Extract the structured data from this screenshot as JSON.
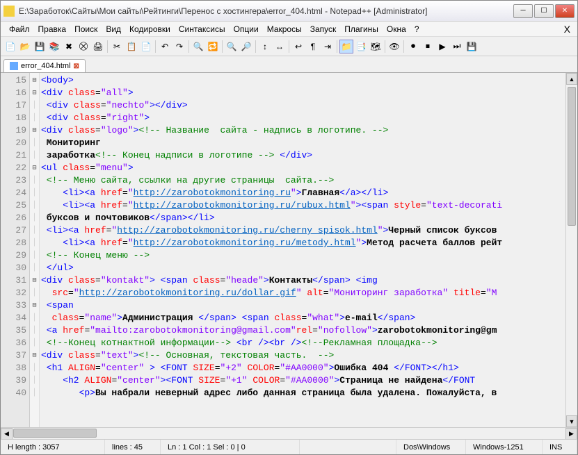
{
  "title": "E:\\Заработок\\Сайты\\Мои сайты\\Рейтинги\\Перенос с хостингера\\error_404.html - Notepad++ [Administrator]",
  "menu": [
    "Файл",
    "Правка",
    "Поиск",
    "Вид",
    "Кодировки",
    "Синтаксисы",
    "Опции",
    "Макросы",
    "Запуск",
    "Плагины",
    "Окна",
    "?"
  ],
  "tab": {
    "name": "error_404.html"
  },
  "status": {
    "length": "H length : 3057",
    "lines": "lines : 45",
    "pos": "Ln : 1   Col : 1   Sel : 0 | 0",
    "eol": "Dos\\Windows",
    "enc": "Windows-1251",
    "mode": "INS"
  },
  "lines": [
    15,
    16,
    17,
    18,
    19,
    20,
    21,
    22,
    23,
    24,
    25,
    26,
    27,
    28,
    29,
    30,
    31,
    32,
    33,
    34,
    35,
    36,
    37,
    38,
    39,
    40
  ],
  "fold": [
    "⊟",
    "⊟",
    "",
    "",
    "⊟",
    "",
    "",
    "⊟",
    "",
    "",
    "",
    "",
    "",
    "",
    "",
    "",
    "⊟",
    "",
    "⊟",
    "",
    "",
    "",
    "⊟",
    "",
    "",
    ""
  ],
  "c15": {
    "tag1": "<body>"
  },
  "c16": {
    "t1": "<div ",
    "a": "class",
    "eq": "=",
    "v": "\"all\"",
    "t2": ">"
  },
  "c17": {
    "t1": " <div ",
    "a": "class",
    "eq": "=",
    "v": "\"nechto\"",
    "t2": "></div>"
  },
  "c18": {
    "t1": " <div ",
    "a": "class",
    "eq": "=",
    "v": "\"right\"",
    "t2": ">"
  },
  "c19": {
    "t1": "<div ",
    "a": "class",
    "eq": "=",
    "v": "\"logo\"",
    "t2": ">",
    "com": "<!-- Название  сайта - надпись в логотипе. -->"
  },
  "c20": {
    "txt": " Мониторинг"
  },
  "c21": {
    "txt": " заработка",
    "com": "<!-- Конец надписи в логотипе -->",
    "t2": " </div>"
  },
  "c22": {
    "t1": "<ul ",
    "a": "class",
    "eq": "=",
    "v": "\"menu\"",
    "t2": ">"
  },
  "c23": {
    "com": " <!-- Меню сайта, ссылки на другие страницы  сайта.-->"
  },
  "c24": {
    "t1": "    <li><a ",
    "a": "href",
    "eq": "=",
    "q": "\"",
    "url": "http://zarobotokmonitoring.ru",
    "q2": "\"",
    "t2": ">",
    "txt": "Главная",
    "t3": "</a></li>"
  },
  "c25": {
    "t1": "    <li><a ",
    "a": "href",
    "eq": "=",
    "q": "\"",
    "url": "http://zarobotokmonitoring.ru/rubux.html",
    "q2": "\"",
    "t2": "><span ",
    "a2": "style",
    "eq2": "=",
    "v2": "\"text-decorati"
  },
  "c26": {
    "txt": " буксов и почтовиков",
    "t1": "</span></li>"
  },
  "c27": {
    "t1": " <li><a ",
    "a": "href",
    "eq": "=",
    "q": "\"",
    "url": "http://zarobotokmonitoring.ru/cherny_spisok.html",
    "q2": "\"",
    "t2": ">",
    "txt": "Черный список буксов"
  },
  "c28": {
    "t1": "    <li><a ",
    "a": "href",
    "eq": "=",
    "q": "\"",
    "url": "http://zarobotokmonitoring.ru/metody.html",
    "q2": "\"",
    "t2": ">",
    "txt": "Метод расчета баллов рейт"
  },
  "c29": {
    "com": " <!-- Конец меню -->"
  },
  "c30": {
    "t1": " </ul>"
  },
  "c31": {
    "t1": "<div ",
    "a": "class",
    "eq": "=",
    "v": "\"kontakt\"",
    "t2": "> <span ",
    "a2": "class",
    "eq2": "=",
    "v2": "\"heade\"",
    "t3": ">",
    "txt": "Контакты",
    "t4": "</span> <img"
  },
  "c32": {
    "a": "  src",
    "eq": "=",
    "q": "\"",
    "url": "http://zarobotokmonitoring.ru/dollar.gif",
    "q2": "\" ",
    "a2": "alt",
    "eq2": "=",
    "v2": "\"Мониторинг заработка\" ",
    "a3": "title",
    "eq3": "=",
    "v3": "\"М"
  },
  "c33": {
    "t1": " <span"
  },
  "c34": {
    "a": "  class",
    "eq": "=",
    "v": "\"name\"",
    "t1": ">",
    "txt": "Администрация ",
    "t2": "</span> <span ",
    "a2": "class",
    "eq2": "=",
    "v2": "\"what\"",
    "t3": ">",
    "txt2": "e-mail",
    "t4": "</span>"
  },
  "c35": {
    "t1": " <a ",
    "a": "href",
    "eq": "=",
    "v": "\"mailto:zarobotokmonitoring@gmail.com\"",
    "a2": "rel",
    "eq2": "=",
    "v2": "\"nofollow\"",
    "t2": ">",
    "txt": "zarobotokmonitoring@gm"
  },
  "c36": {
    "com": " <!--Конец котнактной информации--> ",
    "t1": "<br /><br />",
    "com2": "<!--Рекламная площадка-->"
  },
  "c37": {
    "t1": "<div ",
    "a": "class",
    "eq": "=",
    "v": "\"text\"",
    "t2": ">",
    "com": "<!-- Основная, текстовая часть.  -->"
  },
  "c38": {
    "t1": " <h1 ",
    "a": "ALIGN",
    "eq": "=",
    "v": "\"center\"",
    "t2": " > <FONT ",
    "a2": "SIZE",
    "eq2": "=",
    "v2": "\"+2\" ",
    "a3": "COLOR",
    "eq3": "=",
    "v3": "\"#AA0000\"",
    "t3": ">",
    "txt": "Ошибка 404 ",
    "t4": "</FONT></h1>"
  },
  "c39": {
    "t1": "    <h2 ",
    "a": "ALIGN",
    "eq": "=",
    "v": "\"center\"",
    "t2": "><FONT ",
    "a2": "SIZE",
    "eq2": "=",
    "v2": "\"+1\" ",
    "a3": "COLOR",
    "eq3": "=",
    "v3": "\"#AA0000\"",
    "t3": ">",
    "txt": "Страница не найдена",
    "t4": "</FONT"
  },
  "c40": {
    "t1": "       <p>",
    "txt": "Вы набрали неверный адрес либо данная страница была удалена. Пожалуйста, в"
  }
}
